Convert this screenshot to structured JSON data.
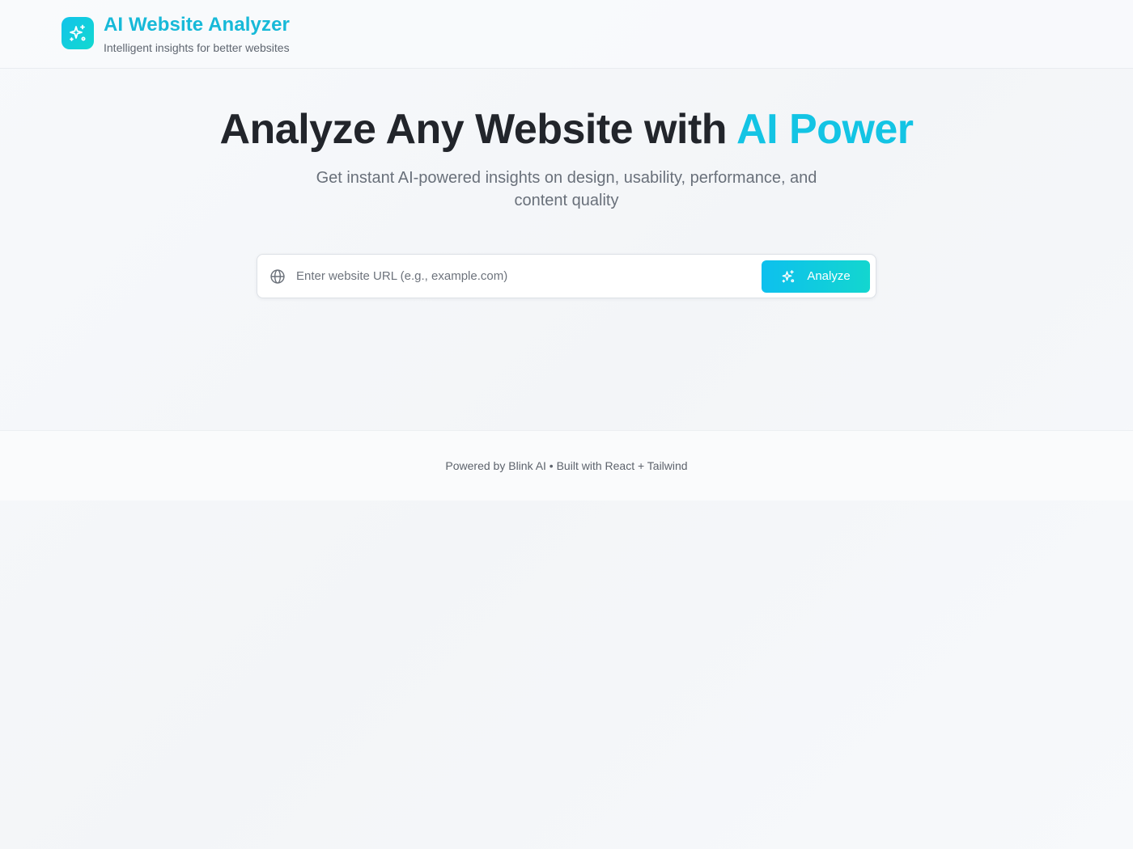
{
  "header": {
    "title": "AI Website Analyzer",
    "subtitle": "Intelligent insights for better websites",
    "logo_icon": "sparkles-icon"
  },
  "hero": {
    "title_main": "Analyze Any Website with ",
    "title_accent": "AI Power",
    "subtitle": "Get instant AI-powered insights on design, usability, performance, and content quality"
  },
  "search": {
    "placeholder": "Enter website URL (e.g., example.com)",
    "value": "",
    "icon": "globe-icon",
    "button_label": "Analyze",
    "button_icon": "sparkles-icon"
  },
  "footer": {
    "text": "Powered by Blink AI • Built with React + Tailwind"
  },
  "colors": {
    "brand": "#17b9d8",
    "accent": "#13c4e4",
    "button_start": "#0dc0ee",
    "button_end": "#13d6cf"
  }
}
